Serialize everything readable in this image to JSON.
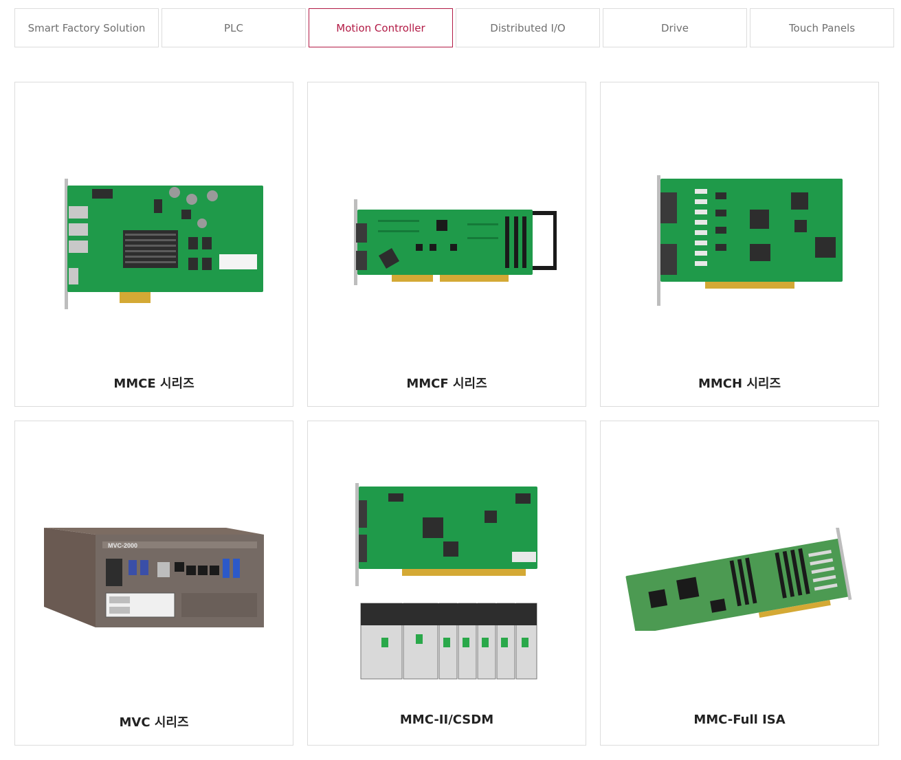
{
  "tabs": [
    {
      "label": "Smart Factory Solution"
    },
    {
      "label": "PLC"
    },
    {
      "label": "Motion Controller",
      "active": true
    },
    {
      "label": "Distributed I/O"
    },
    {
      "label": "Drive"
    },
    {
      "label": "Touch Panels"
    }
  ],
  "colors": {
    "accent": "#b21a45",
    "pcb": "#1f9a4a",
    "border": "#dcdcdc"
  },
  "products": [
    {
      "title": "MMCE 시리즈",
      "icon": "pcie-board-icon"
    },
    {
      "title": "MMCF 시리즈",
      "icon": "pci-board-icon"
    },
    {
      "title": "MMCH 시리즈",
      "icon": "pci-board-icon"
    },
    {
      "title": "MVC 시리즈",
      "icon": "box-pc-icon",
      "device_label": "MVC-2000"
    },
    {
      "title": "MMC-II/CSDM",
      "icon": "board-and-drives-icon"
    },
    {
      "title": "MMC-Full ISA",
      "icon": "isa-board-icon"
    }
  ]
}
